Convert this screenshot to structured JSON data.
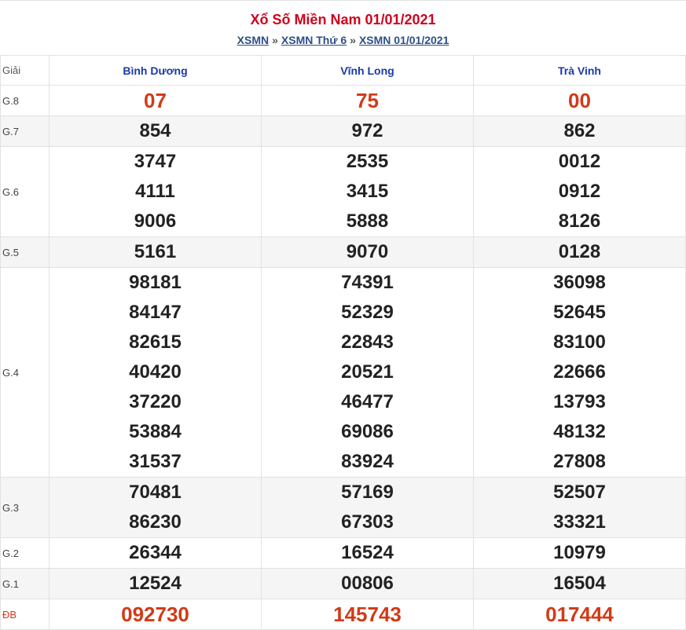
{
  "header": {
    "title": "Xổ Số Miền Nam 01/01/2021",
    "breadcrumb": [
      "XSMN",
      "XSMN Thứ 6",
      "XSMN 01/01/2021"
    ],
    "separator": "»"
  },
  "table": {
    "prize_header": "Giải",
    "provinces": [
      "Bình Dương",
      "Vĩnh Long",
      "Trà Vinh"
    ],
    "rows": [
      {
        "prize": "G.8",
        "values": [
          [
            "07"
          ],
          [
            "75"
          ],
          [
            "00"
          ]
        ]
      },
      {
        "prize": "G.7",
        "values": [
          [
            "854"
          ],
          [
            "972"
          ],
          [
            "862"
          ]
        ]
      },
      {
        "prize": "G.6",
        "values": [
          [
            "3747",
            "4111",
            "9006"
          ],
          [
            "2535",
            "3415",
            "5888"
          ],
          [
            "0012",
            "0912",
            "8126"
          ]
        ]
      },
      {
        "prize": "G.5",
        "values": [
          [
            "5161"
          ],
          [
            "9070"
          ],
          [
            "0128"
          ]
        ]
      },
      {
        "prize": "G.4",
        "values": [
          [
            "98181",
            "84147",
            "82615",
            "40420",
            "37220",
            "53884",
            "31537"
          ],
          [
            "74391",
            "52329",
            "22843",
            "20521",
            "46477",
            "69086",
            "83924"
          ],
          [
            "36098",
            "52645",
            "83100",
            "22666",
            "13793",
            "48132",
            "27808"
          ]
        ]
      },
      {
        "prize": "G.3",
        "values": [
          [
            "70481",
            "86230"
          ],
          [
            "57169",
            "67303"
          ],
          [
            "52507",
            "33321"
          ]
        ]
      },
      {
        "prize": "G.2",
        "values": [
          [
            "26344"
          ],
          [
            "16524"
          ],
          [
            "10979"
          ]
        ]
      },
      {
        "prize": "G.1",
        "values": [
          [
            "12524"
          ],
          [
            "00806"
          ],
          [
            "16504"
          ]
        ]
      },
      {
        "prize": "ĐB",
        "values": [
          [
            "092730"
          ],
          [
            "145743"
          ],
          [
            "017444"
          ]
        ]
      }
    ]
  },
  "colors": {
    "title": "#d0021b",
    "link": "#2d4f86",
    "province": "#1a3aa6",
    "highlight": "#d23a17",
    "alt_row": "#f5f5f5"
  }
}
